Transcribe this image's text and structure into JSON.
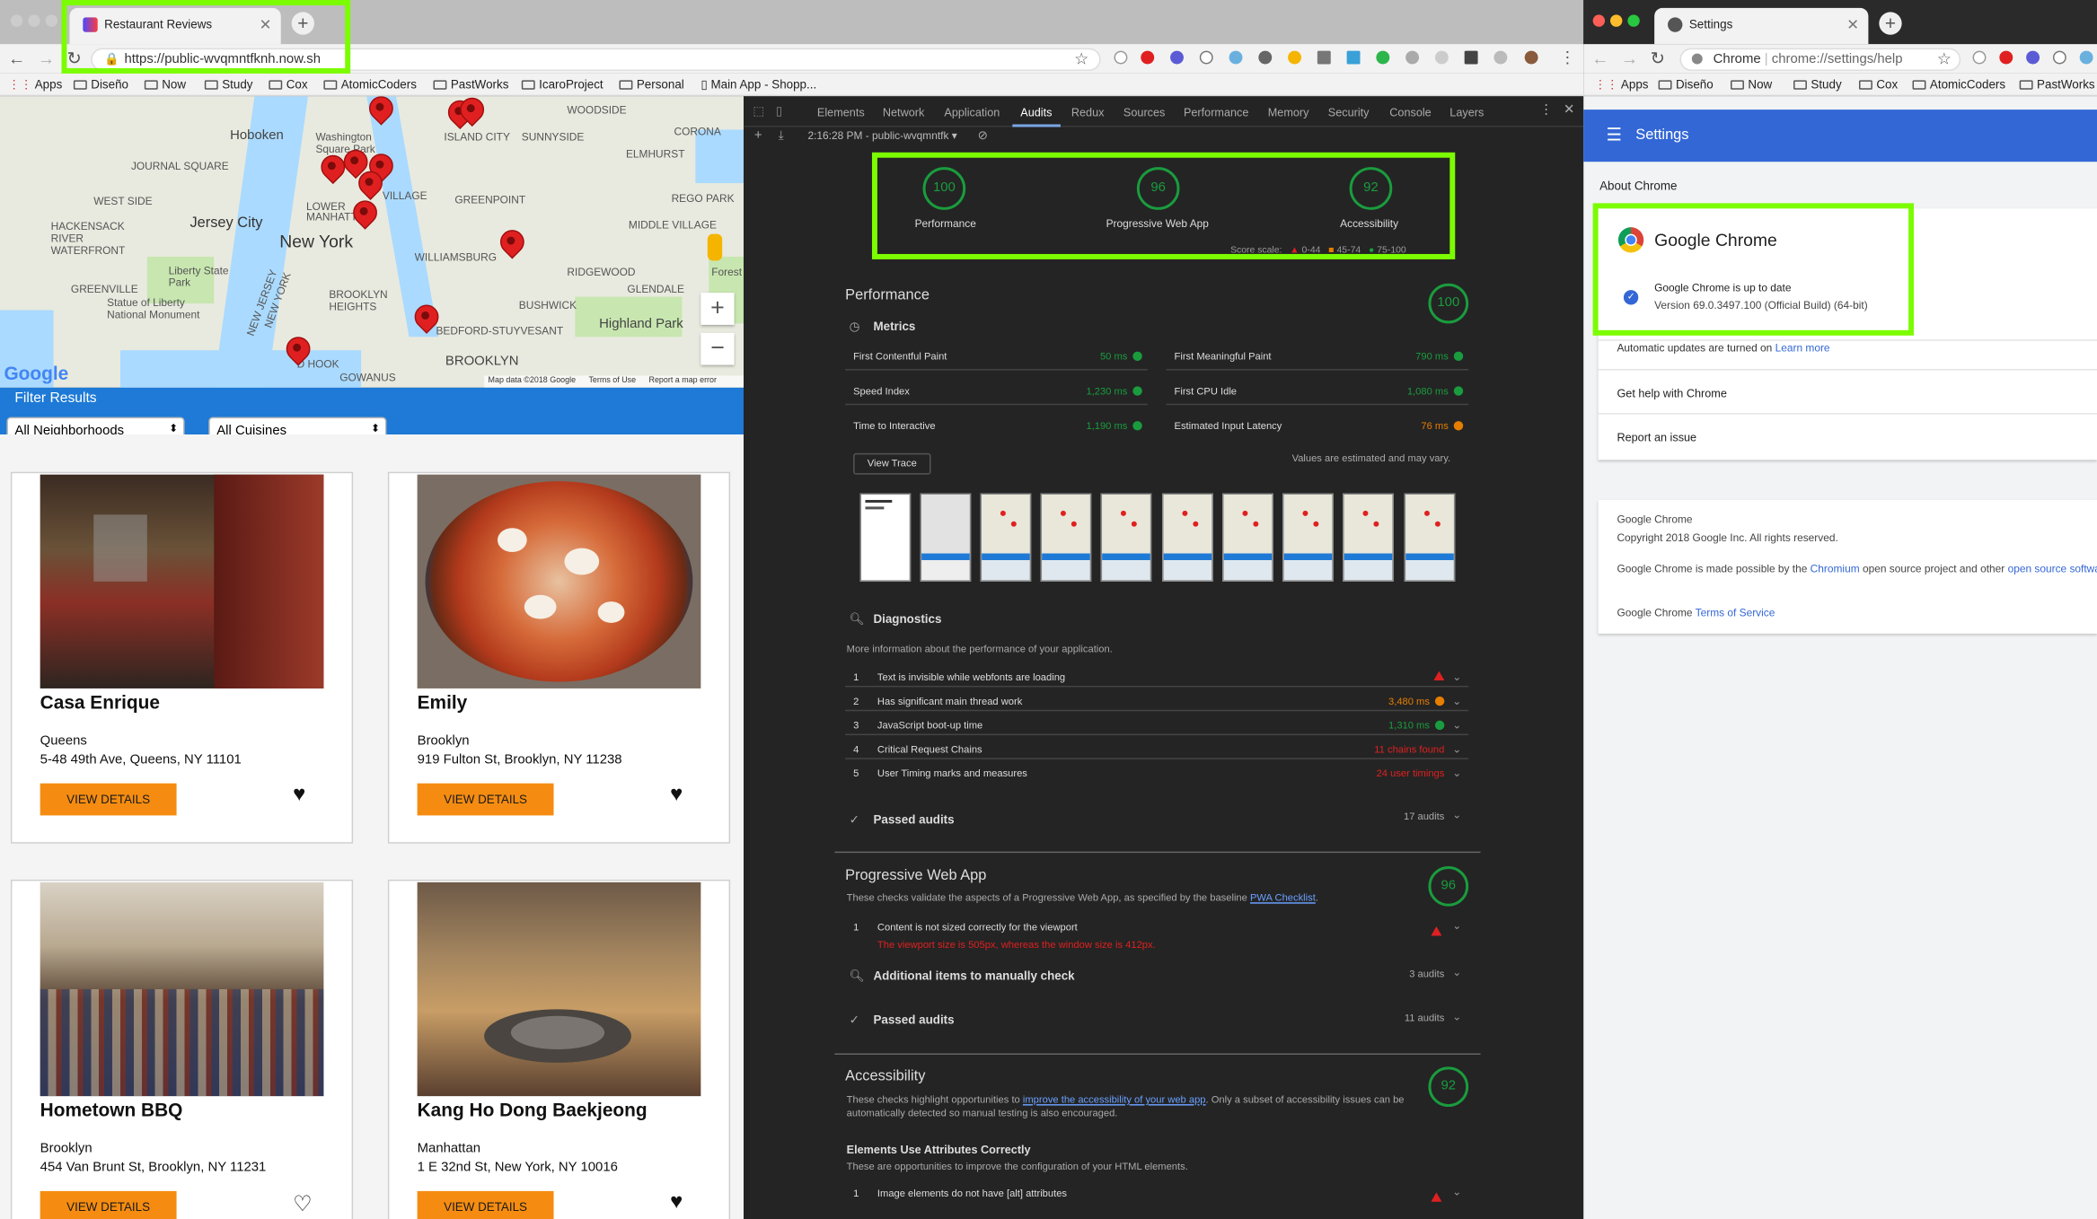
{
  "left_window": {
    "tab_title": "Restaurant Reviews",
    "url": "https://public-wvqmntfknh.now.sh",
    "bookmarks": [
      "Apps",
      "Diseño",
      "Now",
      "Study",
      "Cox",
      "AtomicCoders",
      "PastWorks",
      "IcaroProject",
      "Personal",
      "Main App - Shopp..."
    ]
  },
  "map": {
    "labels": [
      "Hoboken",
      "Washington Square Park",
      "JOURNAL SQUARE",
      "WEST SIDE",
      "Jersey City",
      "New York",
      "HACKENSACK RIVER WATERFRONT",
      "Liberty State Park",
      "Statue of Liberty National Monument",
      "GREENVILLE",
      "NEW JERSEY",
      "NEW YORK",
      "WILLIAMSBURG",
      "GREENPOINT",
      "BROOKLYN HEIGHTS",
      "BUSHWICK",
      "BEDFORD-STUYVESANT",
      "Highland Park",
      "BROOKLYN",
      "RIDGEWOOD",
      "GLENDALE",
      "MIDDLE VILLAGE",
      "CORONA",
      "ELMHURST",
      "REGO PARK",
      "SUNNYSIDE",
      "ISLAND CITY",
      "WOODSIDE",
      "GOWANUS",
      "D HOOK",
      "LOWER MANHATTAN",
      "VILLAGE",
      "Forest"
    ],
    "google_logo": "Google",
    "footer": [
      "Map data ©2018 Google",
      "Terms of Use",
      "Report a map error"
    ],
    "zoom_in": "+",
    "zoom_out": "−"
  },
  "filter": {
    "title": "Filter Results",
    "neighborhood": "All Neighborhoods",
    "cuisine": "All Cuisines"
  },
  "restaurants": [
    {
      "name": "Casa Enrique",
      "neighborhood": "Queens",
      "address": "5-48 49th Ave, Queens, NY 11101",
      "button": "VIEW DETAILS",
      "favorite": true
    },
    {
      "name": "Emily",
      "neighborhood": "Brooklyn",
      "address": "919 Fulton St, Brooklyn, NY 11238",
      "button": "VIEW DETAILS",
      "favorite": true
    },
    {
      "name": "Hometown BBQ",
      "neighborhood": "Brooklyn",
      "address": "454 Van Brunt St, Brooklyn, NY 11231",
      "button": "VIEW DETAILS",
      "favorite": false
    },
    {
      "name": "Kang Ho Dong Baekjeong",
      "neighborhood": "Manhattan",
      "address": "1 E 32nd St, New York, NY 10016",
      "button": "VIEW DETAILS",
      "favorite": true
    }
  ],
  "devtools": {
    "tabs": [
      "Elements",
      "Network",
      "Application",
      "Audits",
      "Redux",
      "Sources",
      "Performance",
      "Memory",
      "Security",
      "Console",
      "Layers"
    ],
    "active_tab": "Audits",
    "report_label": "2:16:28 PM - public-wvqmntfk",
    "gauges": [
      {
        "label": "Performance",
        "score": "100"
      },
      {
        "label": "Progressive Web App",
        "score": "96"
      },
      {
        "label": "Accessibility",
        "score": "92"
      }
    ],
    "score_scale": "Score scale:",
    "scale_ranges": [
      "0-44",
      "45-74",
      "75-100"
    ],
    "performance": {
      "title": "Performance",
      "score": "100",
      "metrics_title": "Metrics",
      "metrics": [
        {
          "name": "First Contentful Paint",
          "value": "50 ms",
          "status": "pass"
        },
        {
          "name": "First Meaningful Paint",
          "value": "790 ms",
          "status": "pass"
        },
        {
          "name": "Speed Index",
          "value": "1,230 ms",
          "status": "pass"
        },
        {
          "name": "First CPU Idle",
          "value": "1,080 ms",
          "status": "pass"
        },
        {
          "name": "Time to Interactive",
          "value": "1,190 ms",
          "status": "pass"
        },
        {
          "name": "Estimated Input Latency",
          "value": "76 ms",
          "status": "average"
        }
      ],
      "view_trace": "View Trace",
      "estimate_note": "Values are estimated and may vary."
    },
    "diagnostics": {
      "title": "Diagnostics",
      "description": "More information about the performance of your application.",
      "items": [
        {
          "num": "1",
          "text": "Text is invisible while webfonts are loading",
          "value": ""
        },
        {
          "num": "2",
          "text": "Has significant main thread work",
          "value": "3,480 ms"
        },
        {
          "num": "3",
          "text": "JavaScript boot-up time",
          "value": "1,310 ms"
        },
        {
          "num": "4",
          "text": "Critical Request Chains",
          "value": "11 chains found"
        },
        {
          "num": "5",
          "text": "User Timing marks and measures",
          "value": "24 user timings"
        }
      ]
    },
    "passed_audits": {
      "label": "Passed audits",
      "count": "17 audits"
    },
    "pwa": {
      "title": "Progressive Web App",
      "score": "96",
      "description": "These checks validate the aspects of a Progressive Web App, as specified by the baseline",
      "checklist_link": "PWA Checklist",
      "failed_item": "Content is not sized correctly for the viewport",
      "failed_detail": "The viewport size is 505px, whereas the window size is 412px.",
      "manual_label": "Additional items to manually check",
      "manual_count": "3 audits",
      "passed_label": "Passed audits",
      "passed_count": "11 audits"
    },
    "accessibility": {
      "title": "Accessibility",
      "score": "92",
      "description_pre": "These checks highlight opportunities to",
      "description_link": "improve the accessibility of your web app",
      "description_post": ". Only a subset of accessibility issues can be automatically detected so manual testing is also encouraged.",
      "group_title": "Elements Use Attributes Correctly",
      "group_desc": "These are opportunities to improve the configuration of your HTML elements.",
      "item_num": "1",
      "item_text": "Image elements do not have [alt] attributes"
    }
  },
  "right_window": {
    "tab_title": "Settings",
    "omni_prefix": "Chrome",
    "url": "chrome://settings/help",
    "bookmarks": [
      "Apps",
      "Diseño",
      "Now",
      "Study",
      "Cox",
      "AtomicCoders",
      "PastWorks"
    ],
    "header": "Settings",
    "about_title": "About Chrome",
    "product": "Google Chrome",
    "status": "Google Chrome is up to date",
    "version": "Version 69.0.3497.100 (Official Build) (64-bit)",
    "auto_updates": "Automatic updates are turned on",
    "learn_more": "Learn more",
    "help": "Get help with Chrome",
    "report": "Report an issue",
    "footer_name": "Google Chrome",
    "copyright": "Copyright 2018 Google Inc. All rights reserved.",
    "made_possible_pre": "Google Chrome is made possible by the",
    "chromium_link": "Chromium",
    "made_possible_mid": "open source project and other",
    "open_source_link": "open source software.",
    "tos_pre": "Google Chrome",
    "tos_link": "Terms of Service"
  },
  "colors": {
    "highlight": "#7cfc00",
    "orange_button": "#f58c11",
    "filter_bar": "#1e7ad6",
    "settings_bar": "#3367d6",
    "pass_green": "#1a9c3e"
  }
}
